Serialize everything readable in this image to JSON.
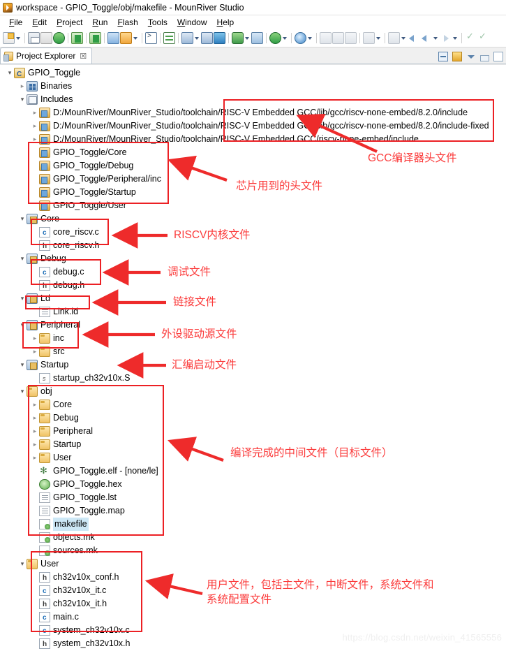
{
  "window": {
    "title": "workspace - GPIO_Toggle/obj/makefile - MounRiver Studio",
    "logo_icon": "mounriver-logo-icon"
  },
  "menubar": [
    {
      "label": "File",
      "mnemonic": "F"
    },
    {
      "label": "Edit",
      "mnemonic": "E"
    },
    {
      "label": "Project",
      "mnemonic": "P"
    },
    {
      "label": "Run",
      "mnemonic": "R"
    },
    {
      "label": "Flash",
      "mnemonic": "F"
    },
    {
      "label": "Tools",
      "mnemonic": "T"
    },
    {
      "label": "Window",
      "mnemonic": "W"
    },
    {
      "label": "Help",
      "mnemonic": "H"
    }
  ],
  "toolbar": {
    "icons": [
      "new-file-icon",
      "new-file-dropdown",
      "save-icon",
      "save-all-icon",
      "build-project-icon",
      "build-all-icon",
      "build-config-icon",
      "new-cproject-icon",
      "manage-configs-icon",
      "manage-configs-dropdown",
      "open-terminal-icon",
      "open-console-icon",
      "download-icon",
      "download-dropdown",
      "download-all-icon",
      "stack-icon",
      "debug-icon",
      "debug-dropdown",
      "run-icon",
      "run-dropdown",
      "search-icon",
      "search-dropdown",
      "next-annotation-icon",
      "previous-annotation-icon",
      "last-edit-icon",
      "toggle-mark-icon",
      "toggle-mark-dropdown",
      "bookmark-icon",
      "bookmark-dropdown",
      "back-small-icon",
      "back-icon",
      "back-dropdown",
      "forward-icon",
      "forward-dropdown",
      "check-icon",
      "check-alt-icon"
    ]
  },
  "view": {
    "tab_label": "Project Explorer",
    "tab_icon": "project-explorer-icon",
    "close_glyph": "☒",
    "tools": [
      "collapse-all-icon",
      "link-with-editor-icon",
      "view-menu-icon",
      "minimize-icon",
      "maximize-icon"
    ]
  },
  "tree": [
    {
      "depth": 0,
      "twisty": "open",
      "icon": "i-proj",
      "label": "GPIO_Toggle"
    },
    {
      "depth": 1,
      "twisty": "closed",
      "icon": "i-bin",
      "label": "Binaries"
    },
    {
      "depth": 1,
      "twisty": "open",
      "icon": "i-inc",
      "label": "Includes"
    },
    {
      "depth": 2,
      "twisty": "closed",
      "icon": "i-incpath",
      "label": "D:/MounRiver/MounRiver_Studio/toolchain/RISC-V Embedded GCC/lib/gcc/riscv-none-embed/8.2.0/include"
    },
    {
      "depth": 2,
      "twisty": "closed",
      "icon": "i-incpath",
      "label": "D:/MounRiver/MounRiver_Studio/toolchain/RISC-V Embedded GCC/lib/gcc/riscv-none-embed/8.2.0/include-fixed"
    },
    {
      "depth": 2,
      "twisty": "closed",
      "icon": "i-incpath",
      "label": "D:/MounRiver/MounRiver_Studio/toolchain/RISC-V Embedded GCC/riscv-none-embed/include"
    },
    {
      "depth": 2,
      "twisty": "none",
      "icon": "i-incpath",
      "label": "GPIO_Toggle/Core"
    },
    {
      "depth": 2,
      "twisty": "none",
      "icon": "i-incpath",
      "label": "GPIO_Toggle/Debug"
    },
    {
      "depth": 2,
      "twisty": "none",
      "icon": "i-incpath",
      "label": "GPIO_Toggle/Peripheral/inc"
    },
    {
      "depth": 2,
      "twisty": "none",
      "icon": "i-incpath",
      "label": "GPIO_Toggle/Startup"
    },
    {
      "depth": 2,
      "twisty": "none",
      "icon": "i-incpath",
      "label": "GPIO_Toggle/User"
    },
    {
      "depth": 1,
      "twisty": "open",
      "icon": "i-srcfold",
      "label": "Core"
    },
    {
      "depth": 2,
      "twisty": "none",
      "icon": "i-cfile",
      "label": "core_riscv.c"
    },
    {
      "depth": 2,
      "twisty": "none",
      "icon": "i-hfile",
      "label": "core_riscv.h"
    },
    {
      "depth": 1,
      "twisty": "open",
      "icon": "i-srcfold",
      "label": "Debug"
    },
    {
      "depth": 2,
      "twisty": "none",
      "icon": "i-cfile",
      "label": "debug.c"
    },
    {
      "depth": 2,
      "twisty": "none",
      "icon": "i-hfile",
      "label": "debug.h"
    },
    {
      "depth": 1,
      "twisty": "open",
      "icon": "i-srcfold",
      "label": "Ld"
    },
    {
      "depth": 2,
      "twisty": "none",
      "icon": "i-txt",
      "label": "Link.ld"
    },
    {
      "depth": 1,
      "twisty": "open",
      "icon": "i-srcfold",
      "label": "Peripheral"
    },
    {
      "depth": 2,
      "twisty": "closed",
      "icon": "i-folder",
      "label": "inc"
    },
    {
      "depth": 2,
      "twisty": "closed",
      "icon": "i-folder",
      "label": "src"
    },
    {
      "depth": 1,
      "twisty": "open",
      "icon": "i-srcfold",
      "label": "Startup"
    },
    {
      "depth": 2,
      "twisty": "none",
      "icon": "i-sfile",
      "label": "startup_ch32v10x.S"
    },
    {
      "depth": 1,
      "twisty": "open",
      "icon": "i-folder",
      "label": "obj"
    },
    {
      "depth": 2,
      "twisty": "closed",
      "icon": "i-folder",
      "label": "Core"
    },
    {
      "depth": 2,
      "twisty": "closed",
      "icon": "i-folder",
      "label": "Debug"
    },
    {
      "depth": 2,
      "twisty": "closed",
      "icon": "i-folder",
      "label": "Peripheral"
    },
    {
      "depth": 2,
      "twisty": "closed",
      "icon": "i-folder",
      "label": "Startup"
    },
    {
      "depth": 2,
      "twisty": "closed",
      "icon": "i-folder",
      "label": "User"
    },
    {
      "depth": 2,
      "twisty": "none",
      "icon": "i-elf",
      "label": "GPIO_Toggle.elf - [none/le]"
    },
    {
      "depth": 2,
      "twisty": "none",
      "icon": "i-hex",
      "label": "GPIO_Toggle.hex"
    },
    {
      "depth": 2,
      "twisty": "none",
      "icon": "i-txt",
      "label": "GPIO_Toggle.lst"
    },
    {
      "depth": 2,
      "twisty": "none",
      "icon": "i-txt",
      "label": "GPIO_Toggle.map"
    },
    {
      "depth": 2,
      "twisty": "none",
      "icon": "i-mk",
      "label": "makefile",
      "selected": true
    },
    {
      "depth": 2,
      "twisty": "none",
      "icon": "i-mk",
      "label": "objects.mk"
    },
    {
      "depth": 2,
      "twisty": "none",
      "icon": "i-mk",
      "label": "sources.mk"
    },
    {
      "depth": 1,
      "twisty": "open",
      "icon": "i-folder",
      "label": "User"
    },
    {
      "depth": 2,
      "twisty": "none",
      "icon": "i-hfile",
      "label": "ch32v10x_conf.h"
    },
    {
      "depth": 2,
      "twisty": "none",
      "icon": "i-cfile",
      "label": "ch32v10x_it.c"
    },
    {
      "depth": 2,
      "twisty": "none",
      "icon": "i-hfile",
      "label": "ch32v10x_it.h"
    },
    {
      "depth": 2,
      "twisty": "none",
      "icon": "i-cfile",
      "label": "main.c"
    },
    {
      "depth": 2,
      "twisty": "none",
      "icon": "i-cfile",
      "label": "system_ch32v10x.c"
    },
    {
      "depth": 2,
      "twisty": "none",
      "icon": "i-hfile",
      "label": "system_ch32v10x.h"
    }
  ],
  "annotations": {
    "color": "#fb3b3b",
    "box_color": "#ec2024",
    "items": [
      {
        "id": "gcc-includes",
        "text": "GCC编译器头文件"
      },
      {
        "id": "chip-headers",
        "text": "芯片用到的头文件"
      },
      {
        "id": "riscv-core",
        "text": "RISCV内核文件"
      },
      {
        "id": "debug-files",
        "text": "调试文件"
      },
      {
        "id": "link-files",
        "text": "链接文件"
      },
      {
        "id": "peripheral-src",
        "text": "外设驱动源文件"
      },
      {
        "id": "startup-asm",
        "text": "汇编启动文件"
      },
      {
        "id": "object-files",
        "text": "编译完成的中间文件（目标文件）"
      },
      {
        "id": "user-files",
        "text": "用户文件，包括主文件，中断文件，系统文件和\n系统配置文件"
      }
    ]
  },
  "watermark": {
    "text": "https://blog.csdn.net/weixin_41565556"
  }
}
